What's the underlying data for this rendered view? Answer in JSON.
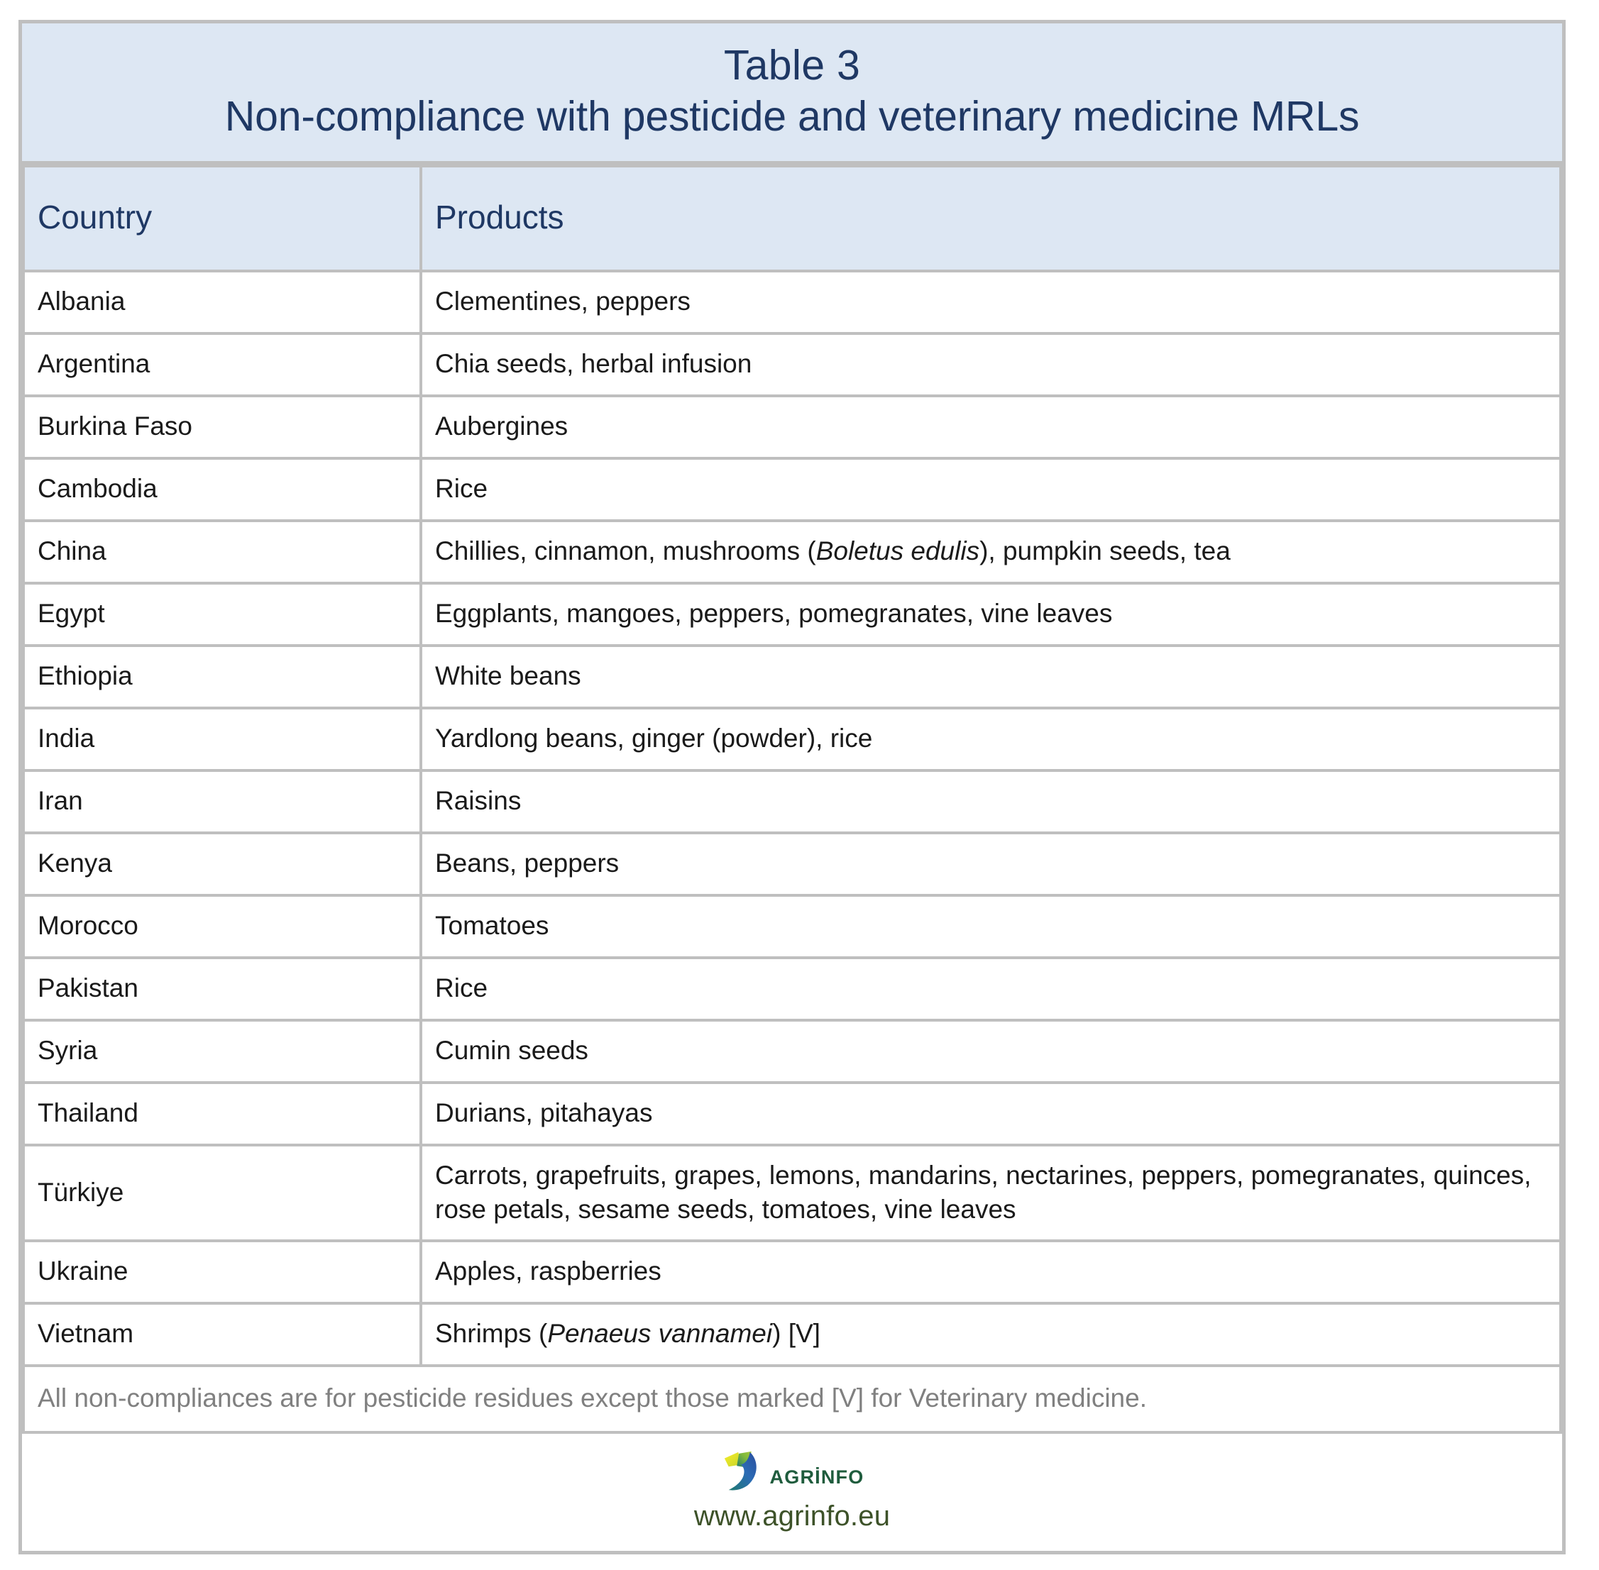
{
  "document": {
    "title_number": "Table 3",
    "title_text": "Non-compliance with pesticide and veterinary medicine MRLs",
    "accent_color": "#1f3864",
    "header_bg": "#dde7f3",
    "border_color": "#bfbfbf",
    "footnote_color": "#808080"
  },
  "table": {
    "columns": [
      {
        "key": "country",
        "label": "Country"
      },
      {
        "key": "products",
        "label": "Products"
      }
    ],
    "rows": [
      {
        "country": "Albania",
        "products": "Clementines, peppers"
      },
      {
        "country": "Argentina",
        "products": "Chia seeds, herbal infusion"
      },
      {
        "country": "Burkina Faso",
        "products": "Aubergines"
      },
      {
        "country": "Cambodia",
        "products": "Rice"
      },
      {
        "country": "China",
        "products": "Chillies, cinnamon, mushrooms (Boletus edulis), pumpkin seeds, tea",
        "products_parts": [
          {
            "text": "Chillies, cinnamon, mushrooms (",
            "italic": false
          },
          {
            "text": "Boletus edulis",
            "italic": true
          },
          {
            "text": "), pumpkin seeds, tea",
            "italic": false
          }
        ]
      },
      {
        "country": "Egypt",
        "products": "Eggplants, mangoes, peppers, pomegranates, vine leaves"
      },
      {
        "country": "Ethiopia",
        "products": "White beans"
      },
      {
        "country": "India",
        "products": "Yardlong beans, ginger (powder), rice"
      },
      {
        "country": "Iran",
        "products": "Raisins"
      },
      {
        "country": "Kenya",
        "products": "Beans, peppers"
      },
      {
        "country": "Morocco",
        "products": "Tomatoes"
      },
      {
        "country": "Pakistan",
        "products": "Rice"
      },
      {
        "country": "Syria",
        "products": "Cumin seeds"
      },
      {
        "country": "Thailand",
        "products": "Durians, pitahayas"
      },
      {
        "country": "Türkiye",
        "products": "Carrots, grapefruits, grapes, lemons, mandarins, nectarines, peppers, pomegranates, quinces, rose petals, sesame seeds, tomatoes, vine leaves"
      },
      {
        "country": "Ukraine",
        "products": "Apples, raspberries"
      },
      {
        "country": "Vietnam",
        "products": "Shrimps (Penaeus vannamei) [V]",
        "products_parts": [
          {
            "text": "Shrimps (",
            "italic": false
          },
          {
            "text": "Penaeus vannamei",
            "italic": true
          },
          {
            "text": ") [V]",
            "italic": false
          }
        ]
      }
    ],
    "footnote": "All non-compliances are for pesticide residues except those marked [V] for Veterinary medicine."
  },
  "footer": {
    "logo_name": "agrinfo-logo",
    "logo_wordmark": "AGRİNFO",
    "site_url": "www.agrinfo.eu",
    "logo_colors": {
      "yellow": "#eee21f",
      "light_green": "#a6c83c",
      "green": "#2e8b57",
      "dark_green": "#1f5c3d",
      "blue": "#2b4f9e",
      "teal": "#1f7a6e"
    }
  }
}
